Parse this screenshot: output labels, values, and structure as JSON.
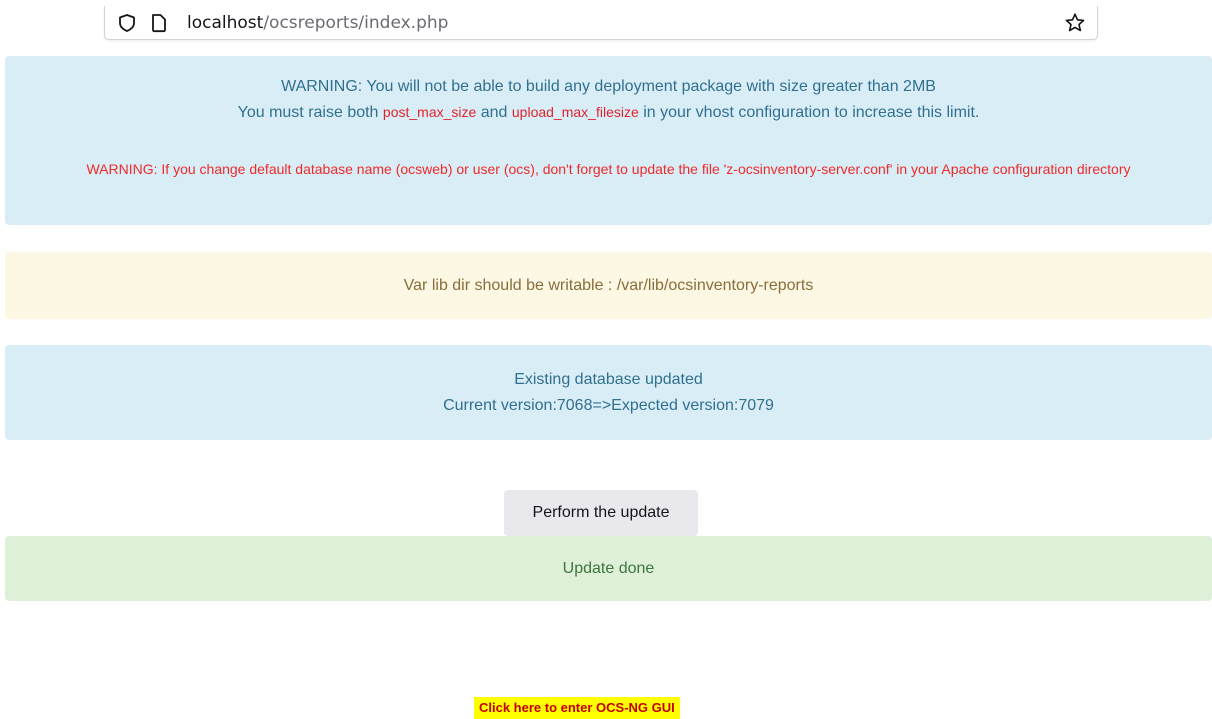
{
  "browser": {
    "url_host": "localhost",
    "url_path": "/ocsreports/index.php"
  },
  "alerts": {
    "size_warning_line1": "WARNING: You will not be able to build any deployment package with size greater than 2MB",
    "size_warning_line2_prefix": "You must raise both ",
    "post_max_size": "post_max_size",
    "size_warning_and": " and ",
    "upload_max_filesize": "upload_max_filesize",
    "size_warning_line2_suffix": " in your vhost configuration to increase this limit.",
    "db_warning": "WARNING: If you change default database name (ocsweb) or user (ocs), don't forget to update the file 'z-ocsinventory-server.conf' in your Apache configuration directory",
    "var_lib_warning": "Var lib dir should be writable : /var/lib/ocsinventory-reports",
    "db_updated_title": "Existing database updated",
    "db_version": "Current version:7068=>Expected version:7079",
    "update_done": "Update done"
  },
  "actions": {
    "perform_update_label": "Perform the update",
    "enter_gui_label": "Click here to enter OCS-NG GUI"
  }
}
